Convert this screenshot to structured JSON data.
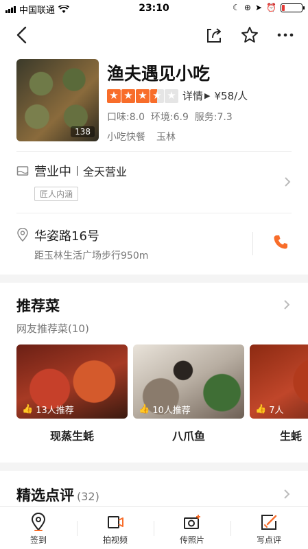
{
  "status_bar": {
    "carrier": "中国联通",
    "time": "23:10"
  },
  "shop": {
    "name": "渔夫遇见小吃",
    "photo_count": "138",
    "rating_stars": 3.5,
    "details_label": "详情",
    "price": "¥58/人",
    "scores": "口味:8.0  环境:6.9  服务:7.3",
    "category": "小吃快餐",
    "area": "玉林"
  },
  "hours": {
    "status": "营业中",
    "detail": "全天营业",
    "badge": "匠人内涵"
  },
  "address": {
    "street": "华姿路16号",
    "distance": "距玉林生活广场步行950m"
  },
  "recommended": {
    "title": "推荐菜",
    "subtitle": "网友推荐菜(10)",
    "dishes": [
      {
        "name": "现蒸生蚝",
        "recommend": "13人推荐"
      },
      {
        "name": "八爪鱼",
        "recommend": "10人推荐"
      },
      {
        "name": "生蚝",
        "recommend": "7人"
      }
    ]
  },
  "reviews": {
    "title": "精选点评",
    "count": "(32)"
  },
  "tabbar": {
    "checkin": "签到",
    "video": "拍视频",
    "photo": "传照片",
    "review": "写点评"
  },
  "colors": {
    "accent": "#f86d2a",
    "text": "#222222",
    "muted": "#777777"
  }
}
